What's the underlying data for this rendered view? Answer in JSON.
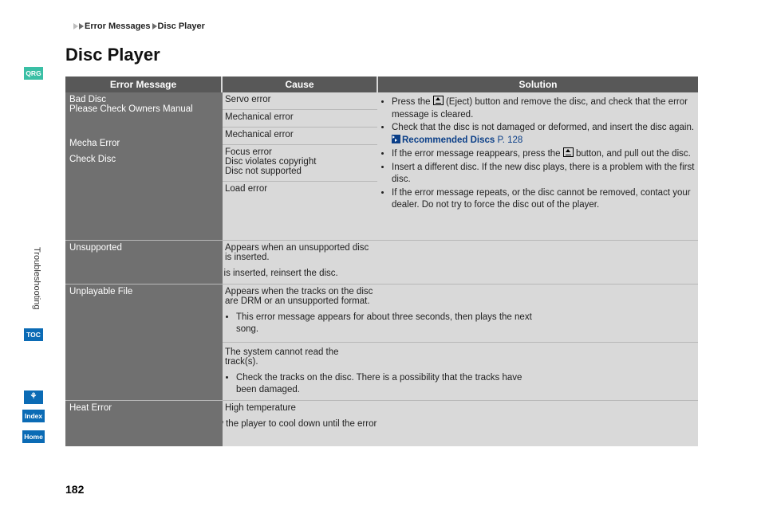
{
  "sidebar": {
    "qrg": "QRG",
    "section": "Troubleshooting",
    "toc": "TOC",
    "voice": "⚘",
    "index": "Index",
    "home": "Home"
  },
  "breadcrumb": {
    "item1": "Error Messages",
    "item2": "Disc Player"
  },
  "title": "Disc Player",
  "headers": {
    "err": "Error Message",
    "cause": "Cause",
    "sol": "Solution"
  },
  "r1": {
    "err1": "Bad Disc",
    "err2": "Please Check Owners Manual",
    "cause1": "Servo error",
    "cause2": "Mechanical error"
  },
  "r2": {
    "err": "Mecha Error",
    "cause": "Mechanical error"
  },
  "r3": {
    "err": "Check Disc",
    "cause1": "Focus error",
    "cause2": "Disc violates copyright",
    "cause3": "Disc not supported",
    "cause4": "Load error"
  },
  "sol1": {
    "b1a": "Press the ",
    "b1b": " (Eject) button and remove the disc, and check that the error message is cleared.",
    "b2": "Check that the disc is not damaged or deformed, and insert the disc again.",
    "xref": "Recommended Discs",
    "xrefpage": " P. 128",
    "b3a": "If the error message reappears, press the ",
    "b3b": " button, and pull out the disc.",
    "b4": "Insert a different disc. If the new disc plays, there is a problem with the first disc.",
    "b5": "If the error message repeats, or the disc cannot be removed, contact your dealer. Do not try to force the disc out of the player."
  },
  "r4": {
    "err": "Unsupported",
    "cause": "Appears when an unsupported disc is inserted.",
    "sol": "If it appears when a supported disc is inserted, reinsert the disc."
  },
  "r5": {
    "err": "Unplayable File",
    "cause1": "Appears when the tracks on the disc are DRM or an unsupported format.",
    "sol1": "This error message appears for about three seconds, then plays the next song.",
    "cause2": "The system cannot read the track(s).",
    "sol2": "Check the tracks on the disc. There is a possibility that the tracks have been damaged."
  },
  "r6": {
    "err": "Heat Error",
    "cause": "High temperature",
    "sol": "Turn the audio system off and allow the player to cool down until the error message is cleared."
  },
  "page": "182"
}
